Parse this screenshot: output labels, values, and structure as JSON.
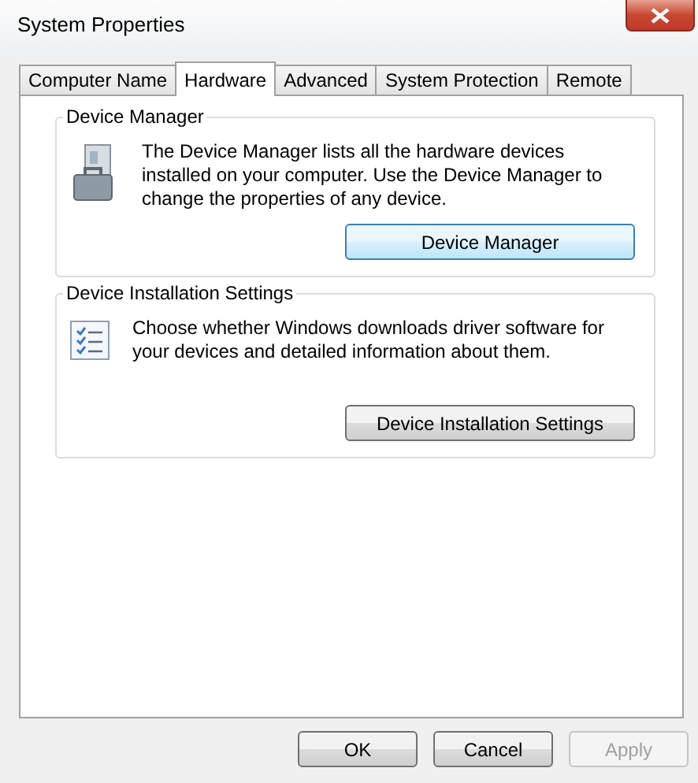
{
  "window": {
    "title": "System Properties"
  },
  "tabs": [
    {
      "label": "Computer Name",
      "selected": false
    },
    {
      "label": "Hardware",
      "selected": true
    },
    {
      "label": "Advanced",
      "selected": false
    },
    {
      "label": "System Protection",
      "selected": false
    },
    {
      "label": "Remote",
      "selected": false
    }
  ],
  "groups": [
    {
      "kind": "device-manager",
      "title": "Device Manager",
      "text": "The Device Manager lists all the hardware devices installed on your computer. Use the Device Manager to change the properties of any device.",
      "button": {
        "label": "Device Manager",
        "focused": true
      }
    },
    {
      "kind": "installation",
      "title": "Device Installation Settings",
      "text": "Choose whether Windows downloads driver software for your devices and detailed information about them.",
      "button": {
        "label": "Device Installation Settings",
        "focused": false
      }
    }
  ],
  "buttons": [
    {
      "label": "OK",
      "disabled": false
    },
    {
      "label": "Cancel",
      "disabled": false
    },
    {
      "label": "Apply",
      "disabled": true
    }
  ]
}
